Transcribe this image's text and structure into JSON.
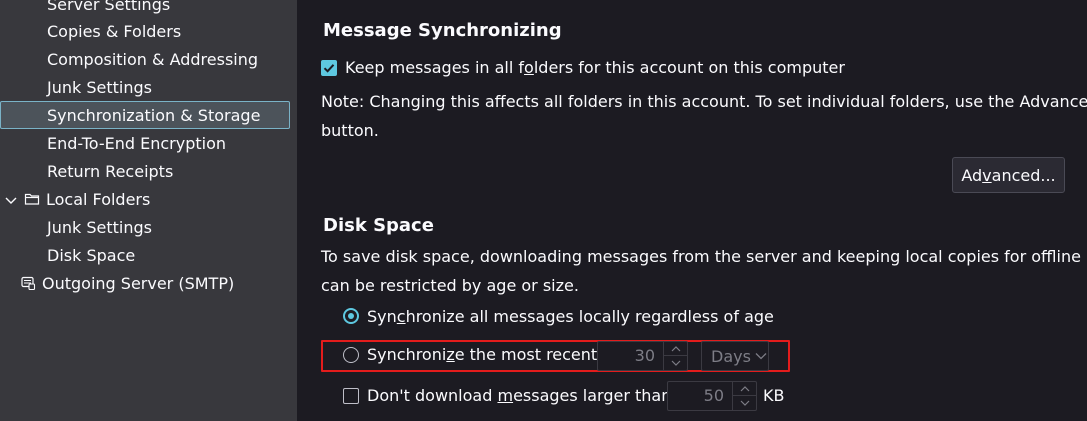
{
  "sidebar": {
    "items": [
      {
        "label": "Server Settings"
      },
      {
        "label": "Copies & Folders"
      },
      {
        "label": "Composition & Addressing"
      },
      {
        "label": "Junk Settings"
      },
      {
        "label": "Synchronization & Storage",
        "selected": true
      },
      {
        "label": "End-To-End Encryption"
      },
      {
        "label": "Return Receipts"
      },
      {
        "label": "Local Folders",
        "expandable": true,
        "icon": "folder-icon"
      },
      {
        "label": "Junk Settings"
      },
      {
        "label": "Disk Space"
      },
      {
        "label": "Outgoing Server (SMTP)",
        "icon": "smtp-server-icon"
      }
    ]
  },
  "sync": {
    "heading": "Message Synchronizing",
    "keep_pre": "Keep messages in all f",
    "keep_accel": "o",
    "keep_post": "lders for this account on this computer",
    "keep_checked": true,
    "note_line1": "Note: Changing this affects all folders in this account. To set individual folders, use the Advanced...",
    "note_line2": "button.",
    "advanced_pre": "Ad",
    "advanced_accel": "v",
    "advanced_post": "anced..."
  },
  "disk": {
    "heading": "Disk Space",
    "desc_line1": "To save disk space, downloading messages from the server and keeping local copies for offline use",
    "desc_line2": "can be restricted by age or size.",
    "radio_all_pre": "Syn",
    "radio_all_accel": "c",
    "radio_all_post": "hronize all messages locally regardless of age",
    "radio_recent_pre": "Synchroni",
    "radio_recent_accel": "z",
    "radio_recent_post": "e the most recent",
    "recent_value": "30",
    "recent_unit": "Days",
    "size_pre": "Don't download ",
    "size_accel": "m",
    "size_post": "essages larger than",
    "size_value": "50",
    "size_unit": "KB"
  },
  "colors": {
    "accent": "#5ec8e0",
    "highlight": "#e31c1c",
    "sidebar_bg": "#38383d",
    "main_bg": "#1c1b22"
  }
}
